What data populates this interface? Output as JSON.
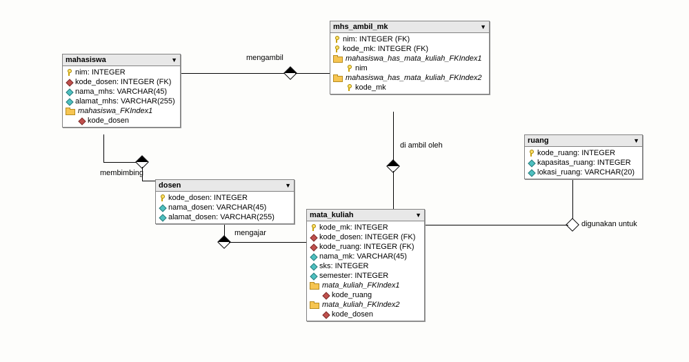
{
  "tables": {
    "mahasiswa": {
      "title": "mahasiswa",
      "cols": [
        {
          "icon": "key",
          "text": "nim: INTEGER"
        },
        {
          "icon": "fk",
          "text": "kode_dosen: INTEGER (FK)"
        },
        {
          "icon": "col",
          "text": "nama_mhs: VARCHAR(45)"
        },
        {
          "icon": "col",
          "text": "alamat_mhs: VARCHAR(255)"
        }
      ],
      "indexes": [
        {
          "name": "mahasiswa_FKIndex1",
          "cols": [
            {
              "icon": "fk",
              "text": "kode_dosen"
            }
          ]
        }
      ]
    },
    "mhs_ambil_mk": {
      "title": "mhs_ambil_mk",
      "cols": [
        {
          "icon": "key",
          "text": "nim: INTEGER (FK)"
        },
        {
          "icon": "key",
          "text": "kode_mk: INTEGER (FK)"
        }
      ],
      "indexes": [
        {
          "name": "mahasiswa_has_mata_kuliah_FKIndex1",
          "cols": [
            {
              "icon": "key",
              "text": "nim"
            }
          ]
        },
        {
          "name": "mahasiswa_has_mata_kuliah_FKIndex2",
          "cols": [
            {
              "icon": "key",
              "text": "kode_mk"
            }
          ]
        }
      ]
    },
    "dosen": {
      "title": "dosen",
      "cols": [
        {
          "icon": "key",
          "text": "kode_dosen: INTEGER"
        },
        {
          "icon": "col",
          "text": "nama_dosen: VARCHAR(45)"
        },
        {
          "icon": "col",
          "text": "alamat_dosen: VARCHAR(255)"
        }
      ],
      "indexes": []
    },
    "mata_kuliah": {
      "title": "mata_kuliah",
      "cols": [
        {
          "icon": "key",
          "text": "kode_mk: INTEGER"
        },
        {
          "icon": "fk",
          "text": "kode_dosen: INTEGER (FK)"
        },
        {
          "icon": "fk",
          "text": "kode_ruang: INTEGER (FK)"
        },
        {
          "icon": "col",
          "text": "nama_mk: VARCHAR(45)"
        },
        {
          "icon": "col",
          "text": "sks: INTEGER"
        },
        {
          "icon": "col",
          "text": "semester: INTEGER"
        }
      ],
      "indexes": [
        {
          "name": "mata_kuliah_FKIndex1",
          "cols": [
            {
              "icon": "fk",
              "text": "kode_ruang"
            }
          ]
        },
        {
          "name": "mata_kuliah_FKIndex2",
          "cols": [
            {
              "icon": "fk",
              "text": "kode_dosen"
            }
          ]
        }
      ]
    },
    "ruang": {
      "title": "ruang",
      "cols": [
        {
          "icon": "key",
          "text": "kode_ruang: INTEGER"
        },
        {
          "icon": "col",
          "text": "kapasitas_ruang: INTEGER"
        },
        {
          "icon": "col",
          "text": "lokasi_ruang: VARCHAR(20)"
        }
      ],
      "indexes": []
    }
  },
  "relationships": {
    "mengambil": "mengambil",
    "membimbing": "membimbing",
    "mengajar": "mengajar",
    "di_ambil_oleh": "di ambil oleh",
    "digunakan_untuk": "digunakan untuk"
  }
}
